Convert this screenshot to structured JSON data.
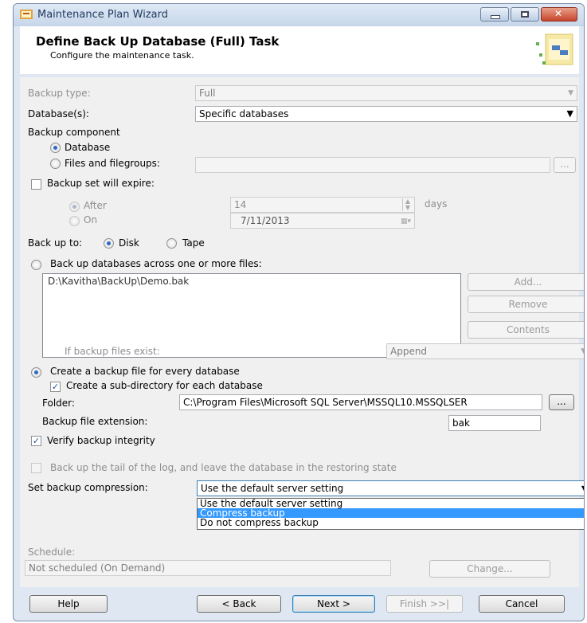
{
  "window": {
    "title": "Maintenance Plan Wizard"
  },
  "header": {
    "title": "Define Back Up Database (Full) Task",
    "subtitle": "Configure the maintenance task."
  },
  "form": {
    "backup_type_label": "Backup type:",
    "backup_type_value": "Full",
    "databases_label": "Database(s):",
    "databases_value": "Specific databases",
    "backup_component_label": "Backup component",
    "component_database": "Database",
    "component_files": "Files and filegroups:",
    "expire_label": "Backup set will expire:",
    "after_label": "After",
    "after_value": "14",
    "days_label": "days",
    "on_label": "On",
    "on_value": "7/11/2013",
    "backup_to_label": "Back up to:",
    "disk_label": "Disk",
    "tape_label": "Tape",
    "across_files_label": "Back up databases across one or more files:",
    "files": [
      "D:\\Kavitha\\BackUp\\Demo.bak"
    ],
    "add_label": "Add...",
    "remove_label": "Remove",
    "contents_label": "Contents",
    "if_exist_label": "If backup files exist:",
    "if_exist_value": "Append",
    "every_db_label": "Create a backup file for every database",
    "subdir_label": "Create a sub-directory for each database",
    "folder_label": "Folder:",
    "folder_value": "C:\\Program Files\\Microsoft SQL Server\\MSSQL10.MSSQLSER",
    "browse_label": "...",
    "ext_label": "Backup file extension:",
    "ext_value": "bak",
    "verify_label": "Verify backup integrity",
    "tail_log_label": "Back up the tail of the log, and leave the database in the restoring state",
    "compression_label": "Set backup compression:",
    "compression_value": "Use the default server setting",
    "compression_options": [
      "Use the default server setting",
      "Compress backup",
      "Do not compress backup"
    ],
    "compression_highlighted": "Compress backup",
    "schedule_label": "Schedule:",
    "schedule_value": "Not scheduled (On Demand)",
    "change_label": "Change..."
  },
  "footer": {
    "help": "Help",
    "back": "< Back",
    "next": "Next >",
    "finish": "Finish >>|",
    "cancel": "Cancel"
  },
  "colors": {
    "selection": "#3399ff",
    "dialog_bg": "#f0f0f0",
    "frame": "#dfe8f2"
  }
}
